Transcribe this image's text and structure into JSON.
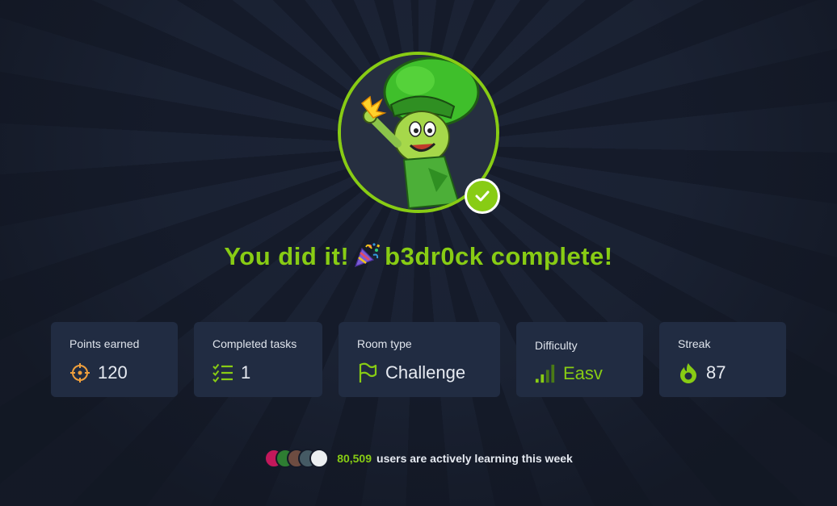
{
  "colors": {
    "accent": "#88cc14",
    "card_bg": "#212c42",
    "page_bg": "#141a28"
  },
  "headline": {
    "prefix": "You did it!",
    "suffix": "b3dr0ck complete!"
  },
  "cards": {
    "points": {
      "label": "Points earned",
      "value": "120",
      "icon": "crosshair-icon"
    },
    "tasks": {
      "label": "Completed tasks",
      "value": "1",
      "icon": "checklist-icon"
    },
    "room": {
      "label": "Room type",
      "value": "Challenge",
      "icon": "flag-icon"
    },
    "difficulty": {
      "label": "Difficulty",
      "value": "Easv",
      "icon": "signal-bars-icon"
    },
    "streak": {
      "label": "Streak",
      "value": "87",
      "icon": "flame-icon"
    }
  },
  "footer": {
    "count": "80,509",
    "text": "users are actively learning this week"
  }
}
